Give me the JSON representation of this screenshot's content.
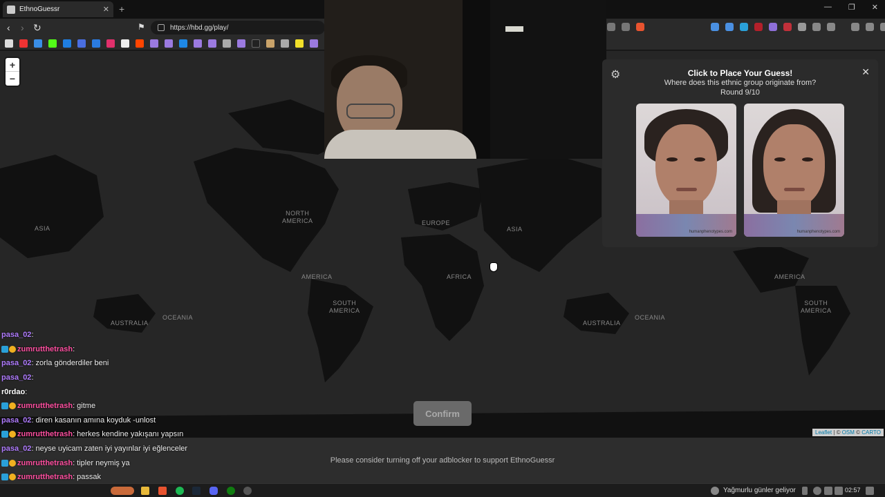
{
  "browser": {
    "tab_title": "EthnoGuessr",
    "tab_close": "✕",
    "new_tab": "+",
    "url": "https://hbd.gg/play/",
    "window_controls": [
      "—",
      "❐",
      "✕"
    ]
  },
  "map": {
    "labels": {
      "asia_left": "ASIA",
      "north_america": "NORTH\nAMERICA",
      "europe": "EUROPE",
      "asia": "ASIA",
      "america_left": "AMERICA",
      "africa": "AFRICA",
      "south_america": "SOUTH\nAMERICA",
      "australia_left": "AUSTRALIA",
      "oceania_left": "OCEANIA",
      "australia": "AUSTRALIA",
      "oceania": "OCEANIA",
      "america_right": "AMERICA",
      "south_america_right": "SOUTH\nAMERICA"
    },
    "zoom_in": "+",
    "zoom_out": "−",
    "attribution": {
      "leaflet": "Leaflet",
      "separator": " | © ",
      "osm": "OSM",
      "carto_sep": " © ",
      "carto": "CARTO"
    }
  },
  "guess_panel": {
    "title": "Click to Place Your Guess!",
    "subtitle": "Where does this ethnic group originate from?",
    "round": "Round 9/10",
    "close": "✕",
    "watermark": "humanphenotypes.com"
  },
  "confirm_label": "Confirm",
  "adblock_message": "Please consider turning off your adblocker to support EthnoGuessr",
  "chat": [
    {
      "user": "pasa_02",
      "color": "#b07cff",
      "badges": false,
      "text": ":"
    },
    {
      "user": "zumrutthetrash",
      "color": "#ff4fa0",
      "badges": true,
      "text": ":"
    },
    {
      "user": "pasa_02",
      "color": "#b07cff",
      "badges": false,
      "text": ": zorla gönderdiler beni"
    },
    {
      "user": "pasa_02",
      "color": "#b07cff",
      "badges": false,
      "text": ":"
    },
    {
      "user": "r0rdao",
      "color": "#ffffff",
      "badges": false,
      "text": ":"
    },
    {
      "user": "zumrutthetrash",
      "color": "#ff4fa0",
      "badges": true,
      "text": ": gitme"
    },
    {
      "user": "pasa_02",
      "color": "#b07cff",
      "badges": false,
      "text": ": diren kasanın amına koyduk -unlost"
    },
    {
      "user": "zumrutthetrash",
      "color": "#ff4fa0",
      "badges": true,
      "text": ": herkes kendine yakışanı yapsın"
    },
    {
      "user": "pasa_02",
      "color": "#b07cff",
      "badges": false,
      "text": ": neyse uyicam zaten iyi yayınlar iyi eğlenceler"
    },
    {
      "user": "zumrutthetrash",
      "color": "#ff4fa0",
      "badges": true,
      "text": ": tipler neymiş ya"
    },
    {
      "user": "zumrutthetrash",
      "color": "#ff4fa0",
      "badges": true,
      "text": ": passak"
    },
    {
      "user": "zumrutthetrash",
      "color": "#ff4fa0",
      "badges": true,
      "text": ":"
    }
  ],
  "taskbar": {
    "weather": "Yağmurlu günler geliyor",
    "time": "02:57"
  }
}
